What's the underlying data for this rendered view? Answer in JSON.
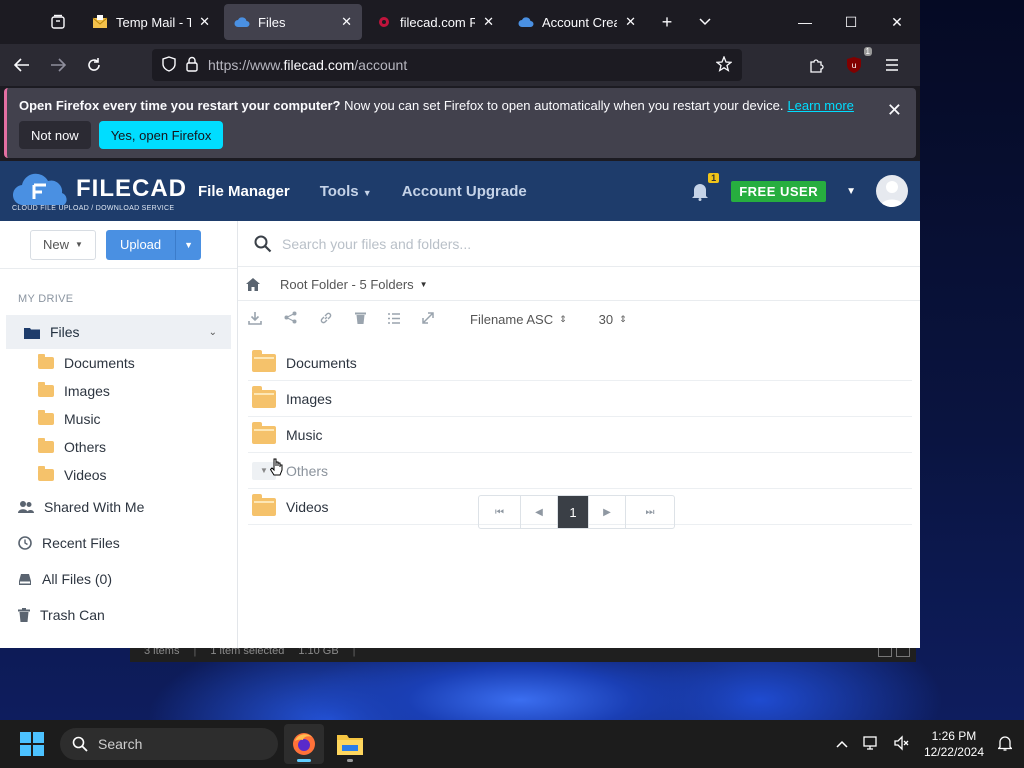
{
  "browser": {
    "tabs": [
      {
        "title": "Temp Mail - Ten",
        "icon": "envelope-icon",
        "active": false
      },
      {
        "title": "Files",
        "icon": "cloud-icon",
        "active": true
      },
      {
        "title": "filecad.com Rev",
        "icon": "record-icon",
        "active": false
      },
      {
        "title": "Account Create",
        "icon": "cloud-icon",
        "active": false
      }
    ],
    "url_prefix": "https://www.",
    "url_domain": "filecad.com",
    "url_path": "/account",
    "extension_badge": "1"
  },
  "notification": {
    "bold": "Open Firefox every time you restart your computer?",
    "text": "Now you can set Firefox to open automatically when you restart your device.",
    "link": "Learn more",
    "not_now": "Not now",
    "yes": "Yes, open Firefox"
  },
  "site": {
    "logo_text": "FILECAD",
    "logo_tagline": "CLOUD FILE UPLOAD / DOWNLOAD SERVICE",
    "nav": {
      "file_manager": "File Manager",
      "tools": "Tools",
      "upgrade": "Account Upgrade"
    },
    "notification_count": "1",
    "user_badge": "FREE USER",
    "colors": {
      "header": "#1e3c6b",
      "free_user": "#27ae3f",
      "upload": "#4a90e2"
    }
  },
  "sidebar": {
    "new_label": "New",
    "upload_label": "Upload",
    "section_label": "MY DRIVE",
    "files_label": "Files",
    "subfolders": [
      "Documents",
      "Images",
      "Music",
      "Others",
      "Videos"
    ],
    "shared": "Shared With Me",
    "recent": "Recent Files",
    "all_files": "All Files (0)",
    "trash": "Trash Can"
  },
  "main": {
    "search_placeholder": "Search your files and folders...",
    "breadcrumb": "Root Folder - 5 Folders",
    "sort": "Filename ASC",
    "per_page": "30",
    "items": [
      "Documents",
      "Images",
      "Music",
      "Others",
      "Videos"
    ],
    "current_page": "1"
  },
  "explorer_status": {
    "items": "3 items",
    "selected": "1 item selected",
    "size": "1.10 GB"
  },
  "taskbar": {
    "search_label": "Search",
    "time": "1:26 PM",
    "date": "12/22/2024"
  }
}
